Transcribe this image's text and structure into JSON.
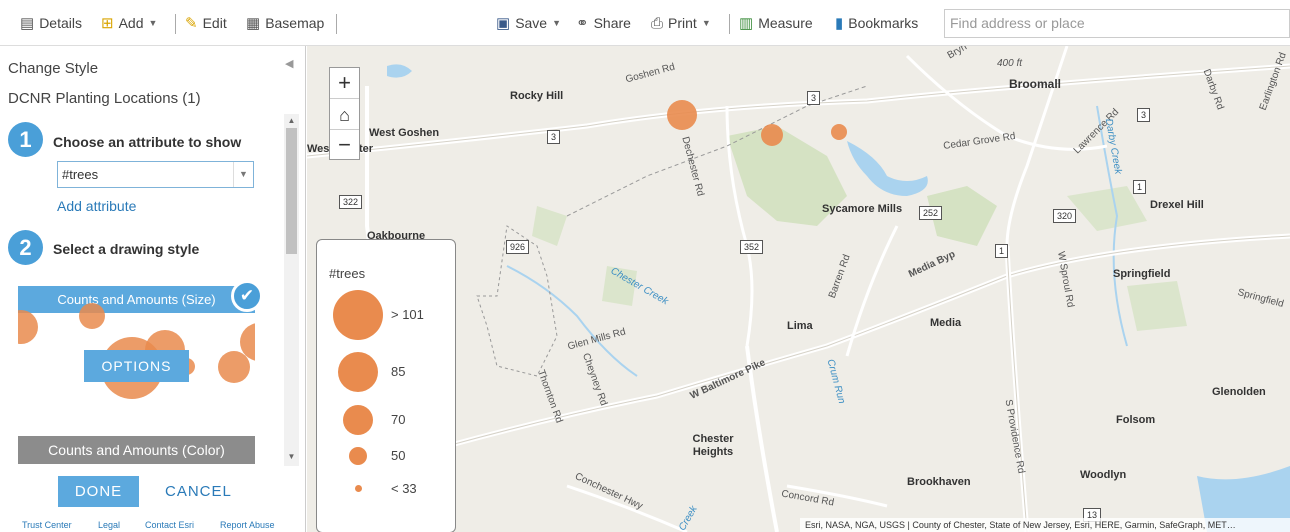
{
  "toolbar": {
    "details": "Details",
    "add": "Add",
    "edit": "Edit",
    "basemap": "Basemap",
    "save": "Save",
    "share": "Share",
    "print": "Print",
    "measure": "Measure",
    "bookmarks": "Bookmarks",
    "search_placeholder": "Find address or place"
  },
  "panel": {
    "title": "Change Style",
    "layer_name": "DCNR Planting Locations (1)",
    "step1": {
      "number": "1",
      "label": "Choose an attribute to show",
      "selected_attribute": "#trees",
      "add_attribute": "Add attribute"
    },
    "step2": {
      "number": "2",
      "label": "Select a drawing style"
    },
    "styles": [
      {
        "label": "Counts and Amounts (Size)",
        "options": "OPTIONS",
        "selected": true
      },
      {
        "label": "Counts and Amounts (Color)"
      }
    ],
    "done": "DONE",
    "cancel": "CANCEL",
    "footer_links": [
      "Trust Center",
      "Legal",
      "Contact Esri",
      "Report Abuse"
    ]
  },
  "map": {
    "zoom_in": "+",
    "zoom_out": "−",
    "place_labels": [
      "Rocky Hill",
      "West Goshen",
      "Wes",
      "ter",
      "Oakbourne",
      "Sycamore Mills",
      "Broomall",
      "Drexel Hill",
      "Springfield",
      "Lima",
      "Media",
      "Glenolden",
      "Folsom",
      "Chester Heights",
      "Brookhaven",
      "Woodlyn"
    ],
    "road_labels": [
      "Goshen Rd",
      "Dechester Rd",
      "Cedar Grove Rd",
      "Lawrence Rd",
      "Darby Rd",
      "Earlington Rd",
      "Media Byp",
      "Barren Rd",
      "Glen Mills Rd",
      "W Baltimore Pike",
      "Cheyney Rd",
      "Thornton Rd",
      "W Sproul Rd",
      "S Providence Rd",
      "Concord Rd",
      "Conchester Hwy",
      "Springfield",
      "Bryn",
      "400 ft"
    ],
    "water_labels": [
      "Chester Creek",
      "Darby Creek",
      "Crum Run",
      "Creek"
    ],
    "shields": [
      "3",
      "3",
      "3",
      "322",
      "926",
      "352",
      "252",
      "1",
      "1",
      "320",
      "13"
    ],
    "legend": {
      "title": "#trees",
      "items": [
        {
          "label": "> 101",
          "value": 101
        },
        {
          "label": "85",
          "value": 85
        },
        {
          "label": "70",
          "value": 70
        },
        {
          "label": "50",
          "value": 50
        },
        {
          "label": "< 33",
          "value": 33
        }
      ]
    },
    "attribution": "Esri, NASA, NGA, USGS | County of Chester, State of New Jersey, Esri, HERE, Garmin, SafeGraph, MET…",
    "point_color": "#e98b4e"
  }
}
